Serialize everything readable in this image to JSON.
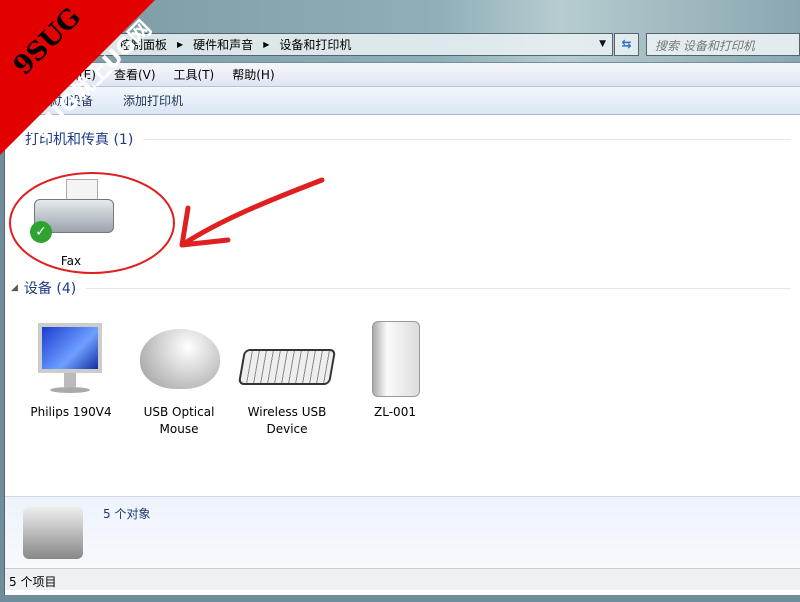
{
  "address": {
    "crumbs": [
      "控制面板",
      "硬件和声音",
      "设备和打印机"
    ]
  },
  "search": {
    "placeholder": "搜索 设备和打印机"
  },
  "menu": [
    "编辑(E)",
    "查看(V)",
    "工具(T)",
    "帮助(H)"
  ],
  "toolbar": {
    "add_device": "添加设备",
    "add_printer": "添加打印机"
  },
  "printers_group": {
    "title": "打印机和传真 (1)",
    "items": [
      {
        "label": "Fax",
        "status": "default"
      }
    ]
  },
  "devices_group": {
    "title": "设备 (4)",
    "items": [
      {
        "label": "Philips 190V4"
      },
      {
        "label": "USB Optical Mouse"
      },
      {
        "label": "Wireless USB Device"
      },
      {
        "label": "ZL-001"
      }
    ]
  },
  "details": {
    "count": "5 个对象"
  },
  "statusbar": {
    "text": "5 个项目"
  },
  "watermark": {
    "line1": "9SUG",
    "line2": "学UG就上UG网"
  }
}
